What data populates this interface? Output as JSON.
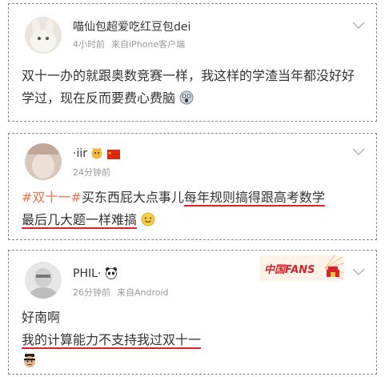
{
  "posts": [
    {
      "username": "喵仙包超爱吃红豆包dei",
      "time": "4小时前",
      "source": "来自iPhone客户端",
      "text": "双十一办的就跟奥数竞赛一样，我这样的学渣当年都没好好学过，现在反而要费心费脑",
      "emoji": "scared-face-emoji"
    },
    {
      "username": "·iir",
      "time": "24分钟前",
      "hashtag": "#双十一#",
      "text_plain": "买东西屁大点事儿",
      "text_underlined_line1": "每年规则搞得跟高考数学",
      "text_underlined_line2": "最后几大题一样难搞",
      "emoji": "smiling-face-emoji"
    },
    {
      "username": "PHIL·",
      "time": "26分钟前",
      "source": "来自Android",
      "text_line1": "好南啊",
      "text_underlined": "我的计算能力不支持我过双十一",
      "badge_text": "中国FANS",
      "emoji": "man-face-emoji"
    }
  ],
  "colors": {
    "underline": "#d8232a",
    "hashtag": "#eb7350",
    "meta": "#999999",
    "text": "#333333"
  }
}
